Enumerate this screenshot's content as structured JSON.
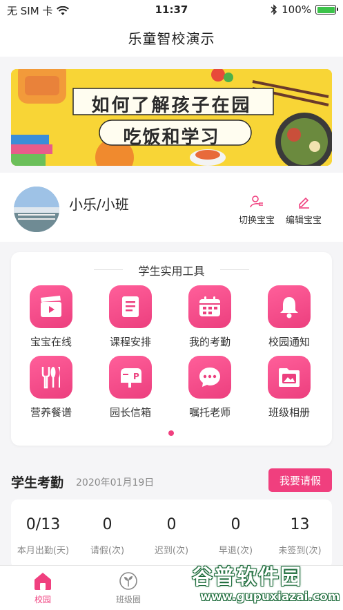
{
  "status_bar": {
    "carrier": "无 SIM 卡",
    "time": "11:37",
    "battery_percent": "100%",
    "battery_level": 1.0,
    "icons": [
      "wifi-icon",
      "bluetooth-icon",
      "battery-icon"
    ]
  },
  "nav": {
    "title": "乐童智校演示"
  },
  "banner": {
    "line1": "如何了解孩子在园",
    "line2": "吃饭和学习"
  },
  "profile": {
    "child_name": "小乐/小班",
    "switch_label": "切换宝宝",
    "edit_label": "编辑宝宝"
  },
  "tools": {
    "title": "学生实用工具",
    "items": [
      {
        "label": "宝宝在线",
        "icon": "video-clapper-icon"
      },
      {
        "label": "课程安排",
        "icon": "book-icon"
      },
      {
        "label": "我的考勤",
        "icon": "calendar-icon"
      },
      {
        "label": "校园通知",
        "icon": "bell-icon"
      },
      {
        "label": "营养餐谱",
        "icon": "cutlery-icon"
      },
      {
        "label": "园长信箱",
        "icon": "mailbox-icon"
      },
      {
        "label": "嘱托老师",
        "icon": "chat-bubble-icon"
      },
      {
        "label": "班级相册",
        "icon": "photo-album-icon"
      }
    ],
    "page_count": 1,
    "current_page": 1
  },
  "attendance": {
    "title": "学生考勤",
    "date": "2020年01月19日",
    "leave_button": "我要请假",
    "stats": [
      {
        "value": "0/13",
        "label": "本月出勤(天)"
      },
      {
        "value": "0",
        "label": "请假(次)"
      },
      {
        "value": "0",
        "label": "迟到(次)"
      },
      {
        "value": "0",
        "label": "早退(次)"
      },
      {
        "value": "13",
        "label": "未签到(次)"
      }
    ]
  },
  "tab_bar": {
    "items": [
      {
        "label": "校园",
        "icon": "home-icon",
        "active": true
      },
      {
        "label": "班级圈",
        "icon": "sprout-icon",
        "active": false
      }
    ]
  },
  "watermark": {
    "text": "谷普软件园",
    "url": "www.gupuxiazai.com"
  },
  "colors": {
    "accent": "#f0407f",
    "banner_bg": "#f8d536",
    "battery_green": "#3cc34a"
  }
}
